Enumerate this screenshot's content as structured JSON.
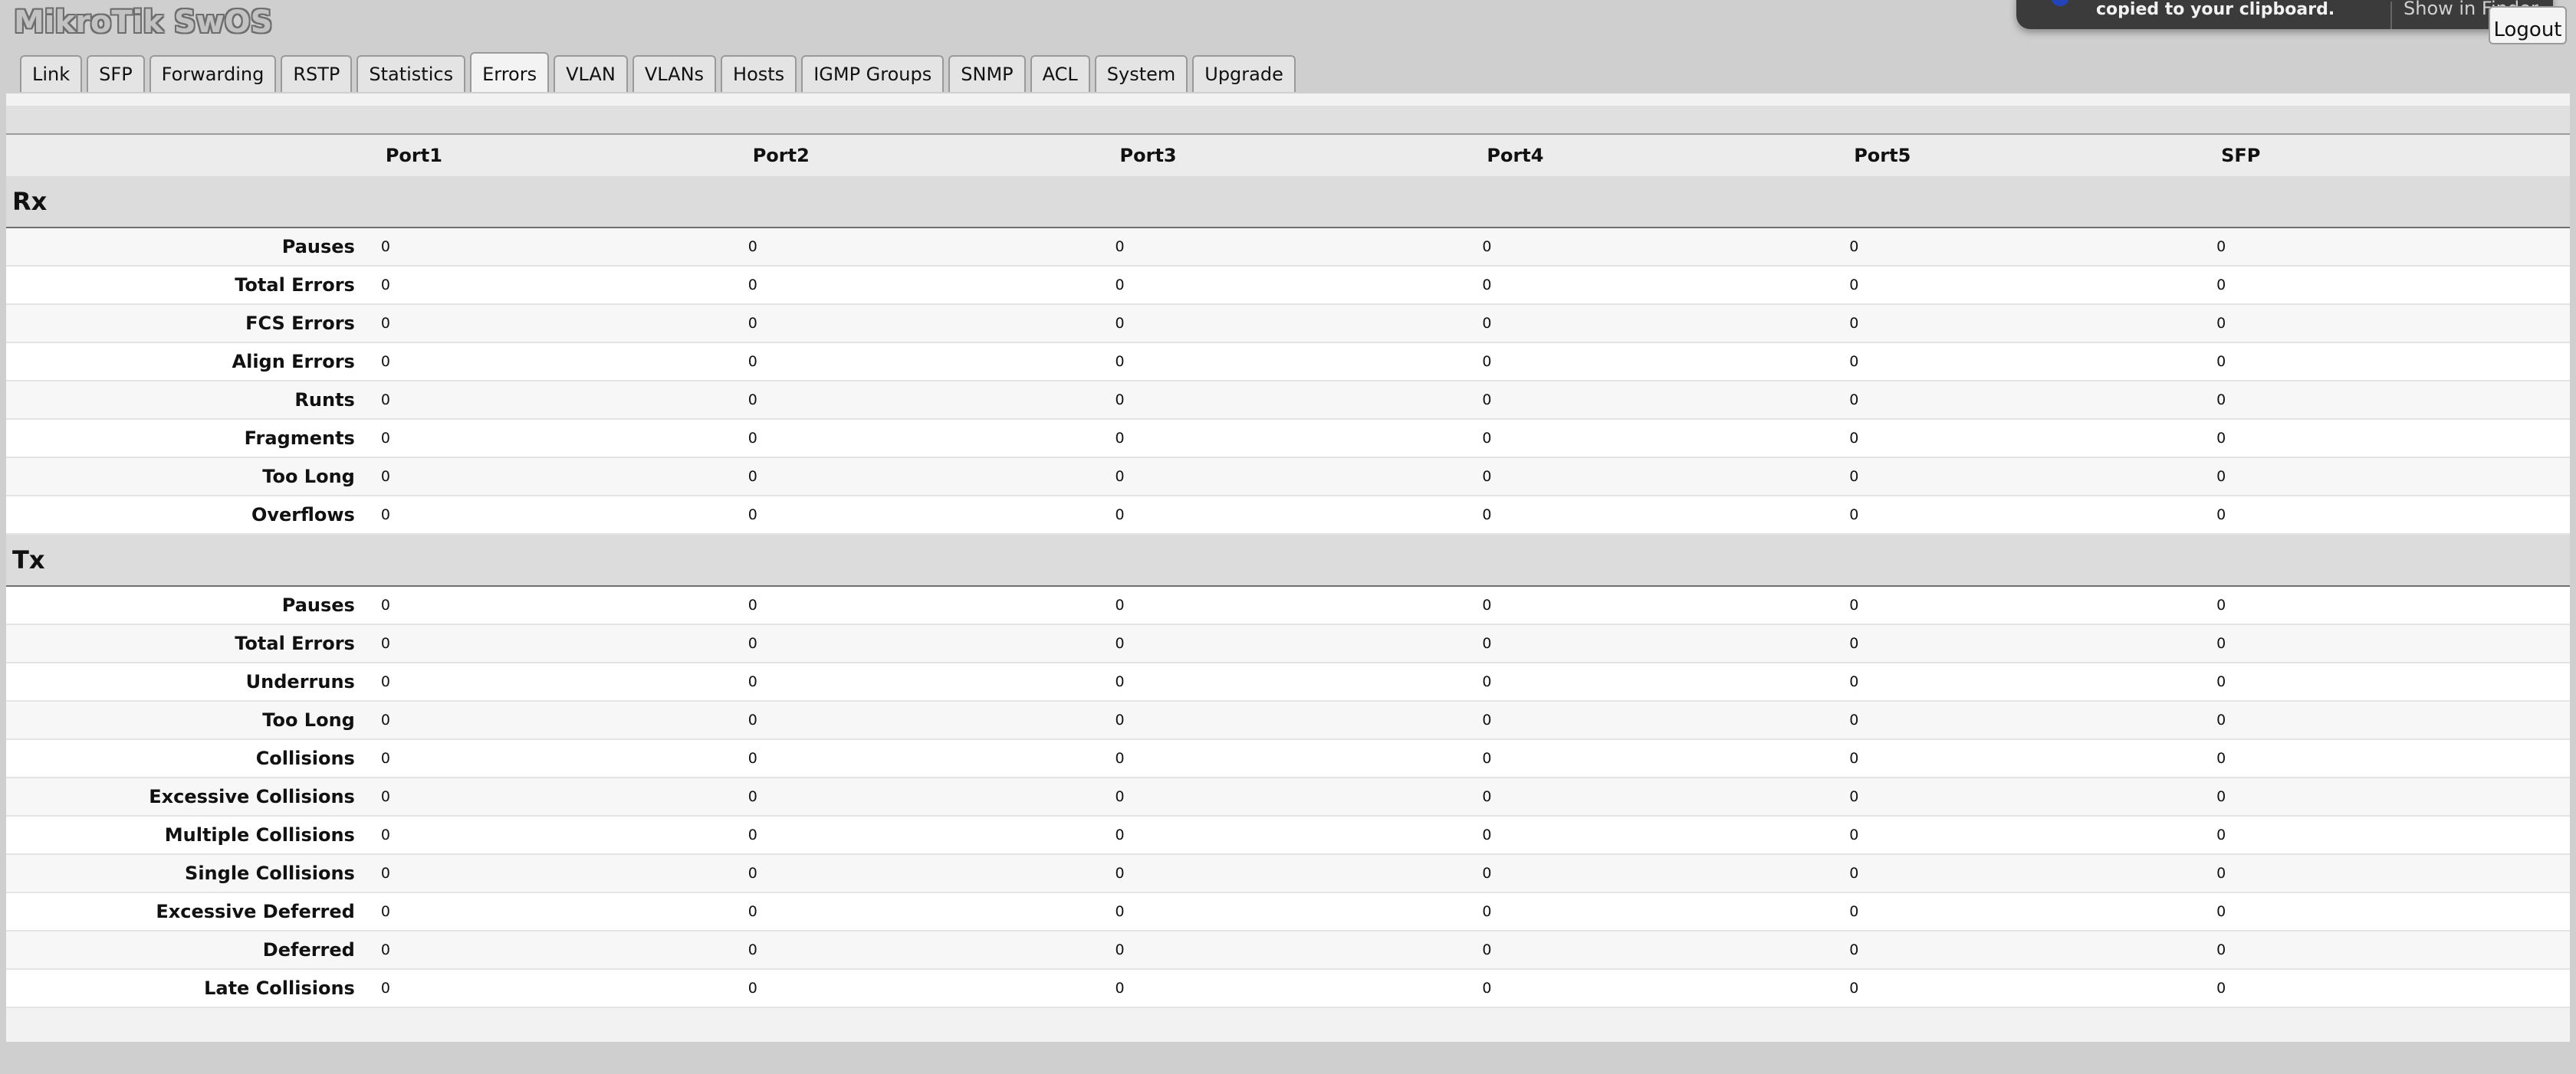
{
  "app": {
    "title": "MikroTik SwOS",
    "logout_label": "Logout"
  },
  "notification": {
    "message": "copied to your clipboard.",
    "action": "Show in Finder"
  },
  "tabs": [
    {
      "label": "Link"
    },
    {
      "label": "SFP"
    },
    {
      "label": "Forwarding"
    },
    {
      "label": "RSTP"
    },
    {
      "label": "Statistics"
    },
    {
      "label": "Errors",
      "active": true
    },
    {
      "label": "VLAN"
    },
    {
      "label": "VLANs"
    },
    {
      "label": "Hosts"
    },
    {
      "label": "IGMP Groups"
    },
    {
      "label": "SNMP"
    },
    {
      "label": "ACL"
    },
    {
      "label": "System"
    },
    {
      "label": "Upgrade"
    }
  ],
  "table": {
    "columns": [
      "Port1",
      "Port2",
      "Port3",
      "Port4",
      "Port5",
      "SFP"
    ],
    "sections": [
      {
        "title": "Rx",
        "rows": [
          {
            "label": "Pauses",
            "values": [
              "0",
              "0",
              "0",
              "0",
              "0",
              "0"
            ]
          },
          {
            "label": "Total Errors",
            "values": [
              "0",
              "0",
              "0",
              "0",
              "0",
              "0"
            ]
          },
          {
            "label": "FCS Errors",
            "values": [
              "0",
              "0",
              "0",
              "0",
              "0",
              "0"
            ]
          },
          {
            "label": "Align Errors",
            "values": [
              "0",
              "0",
              "0",
              "0",
              "0",
              "0"
            ]
          },
          {
            "label": "Runts",
            "values": [
              "0",
              "0",
              "0",
              "0",
              "0",
              "0"
            ]
          },
          {
            "label": "Fragments",
            "values": [
              "0",
              "0",
              "0",
              "0",
              "0",
              "0"
            ]
          },
          {
            "label": "Too Long",
            "values": [
              "0",
              "0",
              "0",
              "0",
              "0",
              "0"
            ]
          },
          {
            "label": "Overflows",
            "values": [
              "0",
              "0",
              "0",
              "0",
              "0",
              "0"
            ]
          }
        ]
      },
      {
        "title": "Tx",
        "rows": [
          {
            "label": "Pauses",
            "values": [
              "0",
              "0",
              "0",
              "0",
              "0",
              "0"
            ]
          },
          {
            "label": "Total Errors",
            "values": [
              "0",
              "0",
              "0",
              "0",
              "0",
              "0"
            ]
          },
          {
            "label": "Underruns",
            "values": [
              "0",
              "0",
              "0",
              "0",
              "0",
              "0"
            ]
          },
          {
            "label": "Too Long",
            "values": [
              "0",
              "0",
              "0",
              "0",
              "0",
              "0"
            ]
          },
          {
            "label": "Collisions",
            "values": [
              "0",
              "0",
              "0",
              "0",
              "0",
              "0"
            ]
          },
          {
            "label": "Excessive Collisions",
            "values": [
              "0",
              "0",
              "0",
              "0",
              "0",
              "0"
            ]
          },
          {
            "label": "Multiple Collisions",
            "values": [
              "0",
              "0",
              "0",
              "0",
              "0",
              "0"
            ]
          },
          {
            "label": "Single Collisions",
            "values": [
              "0",
              "0",
              "0",
              "0",
              "0",
              "0"
            ]
          },
          {
            "label": "Excessive Deferred",
            "values": [
              "0",
              "0",
              "0",
              "0",
              "0",
              "0"
            ]
          },
          {
            "label": "Deferred",
            "values": [
              "0",
              "0",
              "0",
              "0",
              "0",
              "0"
            ]
          },
          {
            "label": "Late Collisions",
            "values": [
              "0",
              "0",
              "0",
              "0",
              "0",
              "0"
            ]
          }
        ]
      }
    ]
  }
}
